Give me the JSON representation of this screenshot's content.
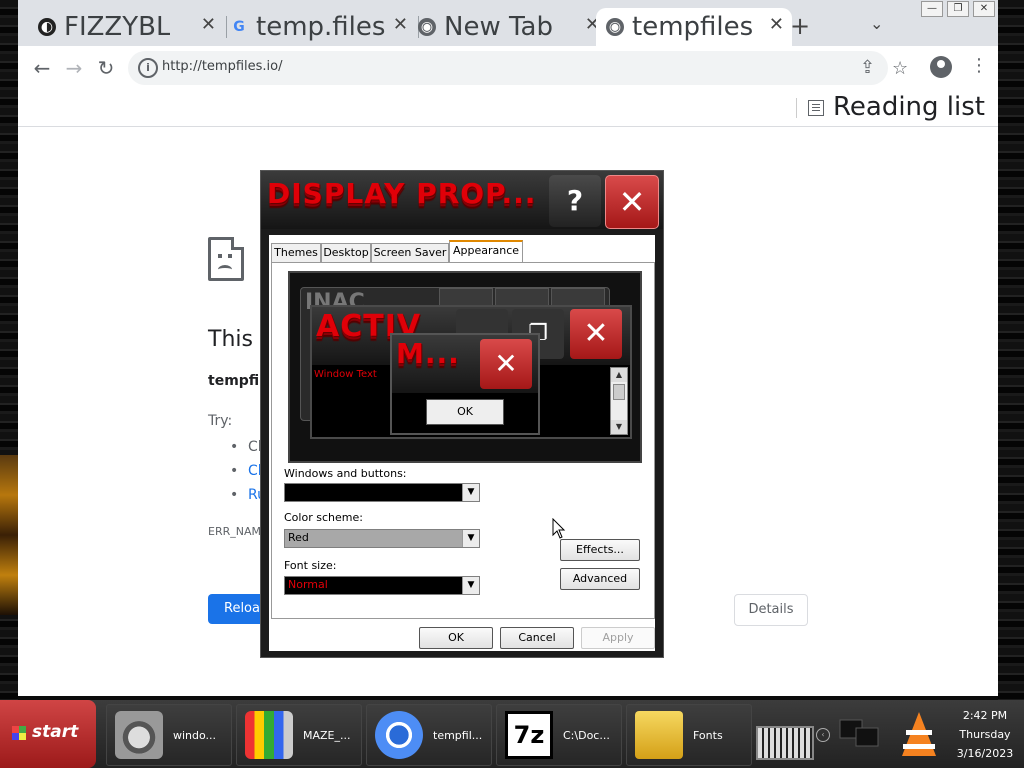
{
  "browser": {
    "tabs": [
      {
        "title": "FIZZYBL",
        "favicon": "globe-dark-icon"
      },
      {
        "title": "temp.files",
        "favicon": "google-icon"
      },
      {
        "title": "New Tab",
        "favicon": "globe-icon"
      },
      {
        "title": "tempfiles",
        "favicon": "globe-icon",
        "active": true
      }
    ],
    "url": "http://tempfiles.io/",
    "reading_list_label": "Reading list"
  },
  "error_page": {
    "title": "This s",
    "host": "tempfil",
    "try_label": "Try:",
    "suggestions": [
      "Cl",
      "Cl",
      "Ru"
    ],
    "error_code": "ERR_NAM",
    "reload_label": "Reloa",
    "details_label": "Details"
  },
  "dialog": {
    "title": "DISPLAY PROP...",
    "help_label": "?",
    "close_label": "✕",
    "tabs": [
      "Themes",
      "Desktop",
      "Screen Saver",
      "Appearance"
    ],
    "selected_tab": "Appearance",
    "preview": {
      "inactive_title": "INAC",
      "active_title": "ACTIV",
      "window_text": "Window Text",
      "message_title": "M...",
      "ok_label": "OK"
    },
    "windows_buttons_label": "Windows and buttons:",
    "windows_buttons_value": "",
    "color_scheme_label": "Color scheme:",
    "color_scheme_value": "Red",
    "font_size_label": "Font size:",
    "font_size_value": "Normal",
    "effects_label": "Effects...",
    "advanced_label": "Advanced",
    "ok_label": "OK",
    "cancel_label": "Cancel",
    "apply_label": "Apply"
  },
  "taskbar": {
    "start_label": "start",
    "tasks": [
      {
        "label": "windo...",
        "icon": "raccoon-icon"
      },
      {
        "label": "MAZE_...",
        "icon": "paint-brushes-icon"
      },
      {
        "label": "tempfil...",
        "icon": "chrome-icon"
      },
      {
        "label": "C:\\Doc...",
        "icon": "7zip-icon"
      },
      {
        "label": "Fonts",
        "icon": "folder-icon"
      }
    ],
    "clock": {
      "time": "2:42 PM",
      "day": "Thursday",
      "date": "3/16/2023"
    }
  },
  "colors": {
    "accent_red": "#e00008",
    "chrome_blue": "#1a73e8",
    "start_red": "#c03030"
  }
}
